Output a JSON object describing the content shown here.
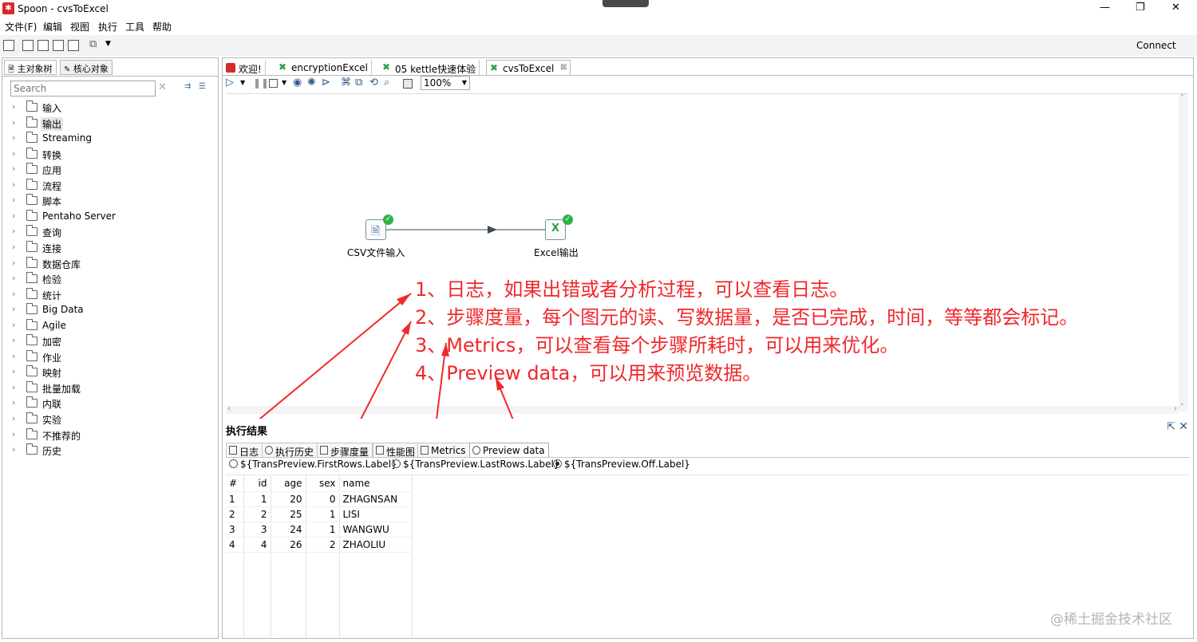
{
  "window": {
    "title": "Spoon - cvsToExcel",
    "controls": {
      "minimize": "—",
      "maximize": "❐",
      "close": "✕"
    }
  },
  "menubar": {
    "items": [
      "文件(F)",
      "编辑",
      "视图",
      "执行",
      "工具",
      "帮助"
    ]
  },
  "toolbar": {
    "connect_label": "Connect"
  },
  "left_panel": {
    "tabs": [
      "主对象树",
      "核心对象"
    ],
    "search_placeholder": "Search",
    "tree": [
      "输入",
      "输出",
      "Streaming",
      "转换",
      "应用",
      "流程",
      "脚本",
      "Pentaho Server",
      "查询",
      "连接",
      "数据仓库",
      "检验",
      "统计",
      "Big Data",
      "Agile",
      "加密",
      "作业",
      "映射",
      "批量加载",
      "内联",
      "实验",
      "不推荐的",
      "历史"
    ],
    "selected_index": 1
  },
  "editor": {
    "tabs": [
      {
        "label": "欢迎!",
        "icon": "spoon-icon",
        "color": "#d42a2a"
      },
      {
        "label": "encryptionExcel",
        "icon": "transformation-icon",
        "color": "#2fa04a"
      },
      {
        "label": "05 kettle快速体验",
        "icon": "transformation-icon",
        "color": "#2fa04a"
      },
      {
        "label": "cvsToExcel",
        "icon": "transformation-icon",
        "color": "#2fa04a",
        "close": "⊠"
      }
    ],
    "zoom": "100%"
  },
  "canvas": {
    "steps": [
      {
        "label": "CSV文件输入",
        "icon": "csv-input-icon"
      },
      {
        "label": "Excel输出",
        "icon": "excel-output-icon"
      }
    ],
    "annotations": [
      "1、日志，如果出错或者分析过程，可以查看日志。",
      "2、步骤度量，每个图元的读、写数据量，是否已完成，时间，等等都会标记。",
      "3、Metrics，可以查看每个步骤所耗时，可以用来优化。",
      "4、Preview data，可以用来预览数据。"
    ],
    "annotation_color": "#f0282c"
  },
  "results": {
    "title": "执行结果",
    "tabs": [
      "日志",
      "执行历史",
      "步骤度量",
      "性能图",
      "Metrics",
      "Preview data"
    ],
    "active_tab": 5,
    "radio_options": [
      "${TransPreview.FirstRows.Label}",
      "${TransPreview.LastRows.Label}",
      "${TransPreview.Off.Label}"
    ],
    "radio_selected": 2,
    "columns": [
      "#",
      "id",
      "age",
      "sex",
      "name"
    ],
    "rows": [
      [
        "1",
        "1",
        "20",
        "0",
        "ZHAGNSAN"
      ],
      [
        "2",
        "2",
        "25",
        "1",
        "LISI"
      ],
      [
        "3",
        "3",
        "24",
        "1",
        "WANGWU"
      ],
      [
        "4",
        "4",
        "26",
        "2",
        "ZHAOLIU"
      ]
    ]
  },
  "watermark": "@稀土掘金技术社区"
}
